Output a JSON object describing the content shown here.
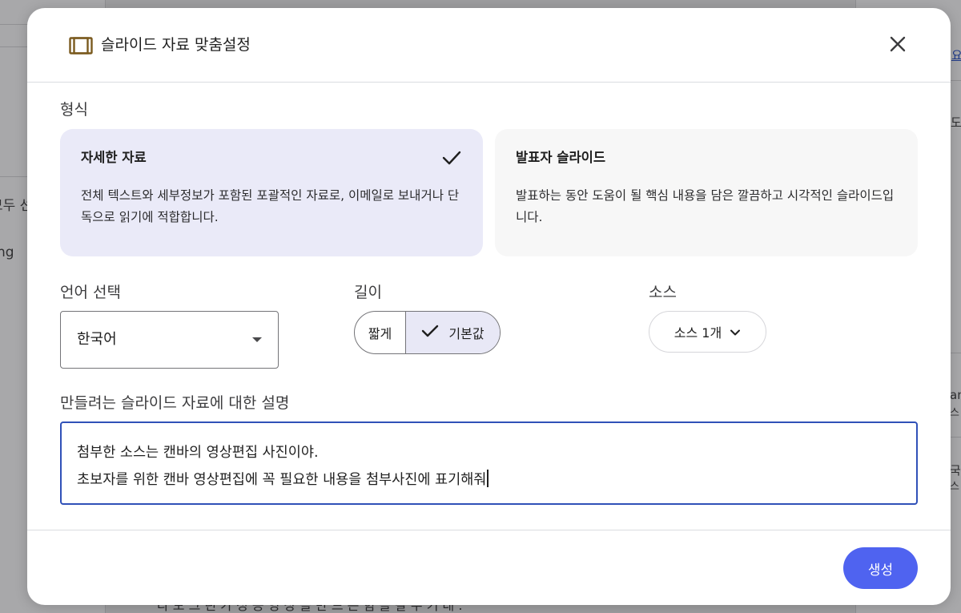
{
  "background": {
    "left_snippets": [
      "모두 선",
      "ng"
    ],
    "right_snippets": [
      "요",
      "도",
      "an",
      "스",
      "국",
      "스"
    ],
    "bottom_snippet": "다 모 그 린 가 성 공 영 상 을 만 드 는 힘 을 갈 수 기 대 ."
  },
  "dialog": {
    "title": "슬라이드 자료 맞춤설정",
    "header_icon": "slides-icon",
    "close_icon": "close-icon",
    "format": {
      "label": "형식",
      "options": [
        {
          "title": "자세한 자료",
          "description": "전체 텍스트와 세부정보가 포함된 포괄적인 자료로, 이메일로 보내거나 단독으로 읽기에 적합합니다.",
          "selected": true
        },
        {
          "title": "발표자 슬라이드",
          "description": "발표하는 동안 도움이 될 핵심 내용을 담은 깔끔하고 시각적인 슬라이드입니다.",
          "selected": false
        }
      ]
    },
    "language": {
      "label": "언어 선택",
      "value": "한국어"
    },
    "length": {
      "label": "길이",
      "options": [
        "짧게",
        "기본값"
      ],
      "selected": "기본값"
    },
    "source": {
      "label": "소스",
      "button_label": "소스 1개"
    },
    "description": {
      "label": "만들려는 슬라이드 자료에 대한 설명",
      "lines": [
        "첨부한 소스는 캔바의 영상편집 사진이야.",
        "초보자를 위한 캔바 영상편집에 꼭 필요한 내용을 첨부사진에 표기해줘"
      ]
    },
    "generate_label": "생성"
  },
  "colors": {
    "accent": "#4f63f0",
    "selected_card": "#eaeaf8",
    "focus_border": "#3051b8"
  }
}
